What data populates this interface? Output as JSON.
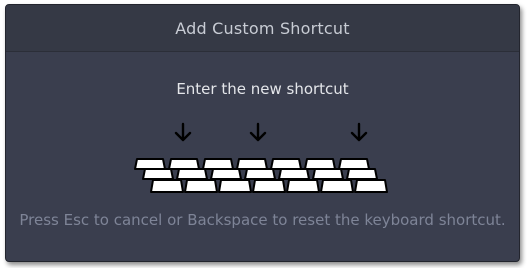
{
  "dialog": {
    "title": "Add Custom Shortcut",
    "prompt": "Enter the new shortcut",
    "hint": "Press Esc to cancel or Backspace to reset the keyboard shortcut.",
    "illustration_icon": "keyboard-icon",
    "arrow_icon": "arrow-down-icon"
  },
  "colors": {
    "background": "#3a3e4e",
    "titlebar": "#353945",
    "key_fill": "#ffffff",
    "key_outline": "#000000"
  }
}
